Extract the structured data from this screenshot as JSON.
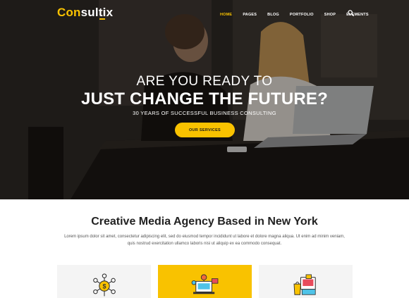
{
  "brand": {
    "name_part1": "Con",
    "name_part2": "sultix",
    "accent": "#f9c200"
  },
  "nav": {
    "items": [
      {
        "label": "HOME",
        "active": true
      },
      {
        "label": "PAGES",
        "active": false
      },
      {
        "label": "BLOG",
        "active": false
      },
      {
        "label": "PORTFOLIO",
        "active": false
      },
      {
        "label": "SHOP",
        "active": false
      },
      {
        "label": "ELEMENTS",
        "active": false
      }
    ],
    "search_icon": "search-icon"
  },
  "hero": {
    "line1": "ARE YOU READY TO",
    "line2": "JUST CHANGE THE FUTURE?",
    "line3": "30 YEARS OF SUCCESSFUL BUSINESS CONSULTING",
    "cta_label": "OUR SERVICES"
  },
  "section": {
    "title": "Creative Media Agency Based in New York",
    "desc_line1": "Lorem ipsum dolor sit amet, consectetur adipiscing elit, sed do eiusmod tempor incididunt ut labore et dolore magna aliqua. Ut enim ad minim veniam,",
    "desc_line2": "quis nostrud exercitation ullamco laboris nisi ut aliquip ex ea commodo consequat."
  },
  "cards": [
    {
      "icon": "dollar-network-icon"
    },
    {
      "icon": "marketing-tools-icon"
    },
    {
      "icon": "online-shopping-icon"
    }
  ]
}
